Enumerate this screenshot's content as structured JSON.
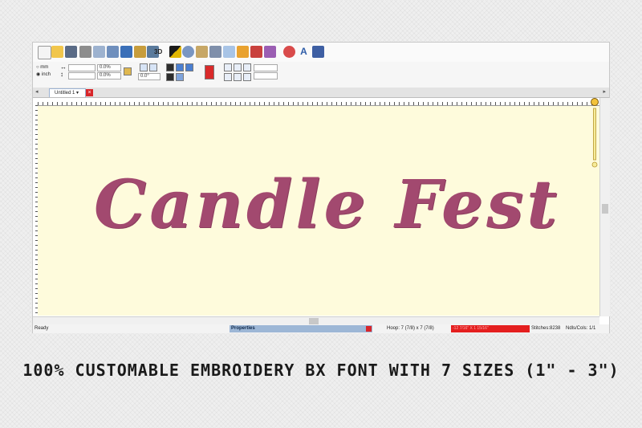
{
  "toolbar": {
    "icons": [
      "new-icon",
      "open-icon",
      "save-icon",
      "print-icon",
      "print-preview-icon",
      "cut-icon",
      "copy-icon",
      "paste-icon",
      "redo-icon",
      "3d-view-icon",
      "color-icon",
      "zoom-icon",
      "measure-icon",
      "stitch-player-icon",
      "select-icon",
      "hoop-icon",
      "thread-icon",
      "pattern-icon",
      "wizard-icon",
      "text-tool-icon",
      "export-icon"
    ],
    "label_3d": "3D",
    "label_text_tool": "A"
  },
  "toolbar2": {
    "unit_mm": "mm",
    "unit_inch": "inch",
    "pct_width": "0.0%",
    "pct_height": "0.0%",
    "rotation": "0.0°"
  },
  "tab": {
    "label": "Untitled 1 ▾"
  },
  "design": {
    "text": "Candle Fest",
    "thread_color": "#a2496f"
  },
  "status": {
    "ready": "Ready",
    "properties": "Properties",
    "hoop": "Hoop: 7 (7/8) x 7 (7/8)",
    "coords": "-12 7/16\" X 1 15/16\"",
    "stitches": "Stitches:8238",
    "ndls": "Ndls/Cols: 1/1"
  },
  "caption": {
    "text": "100% CUSTOMABLE EMBROIDERY BX FONT WITH 7 SIZES (1\" - 3\")"
  }
}
